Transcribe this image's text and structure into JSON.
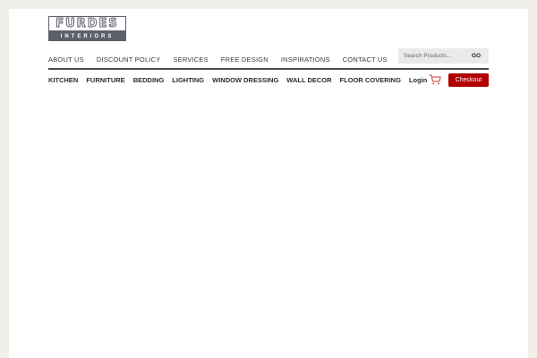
{
  "logo": {
    "top_text": "FURDES",
    "bottom_text": "INTERIORS"
  },
  "top_nav": {
    "items": [
      {
        "label": "ABOUT US"
      },
      {
        "label": "DISCOUNT POLICY"
      },
      {
        "label": "SERVICES"
      },
      {
        "label": "FREE DESIGN"
      },
      {
        "label": "INSPIRATIONS"
      },
      {
        "label": "CONTACT US"
      }
    ],
    "social_icons": [
      "facebook-icon",
      "instagram-icon"
    ]
  },
  "search": {
    "placeholder": "Search Products...",
    "button_label": "GO"
  },
  "category_nav": {
    "items": [
      {
        "label": "KITCHEN"
      },
      {
        "label": "FURNITURE"
      },
      {
        "label": "BEDDING"
      },
      {
        "label": "LIGHTING"
      },
      {
        "label": "WINDOW DRESSING"
      },
      {
        "label": "WALL DECOR"
      },
      {
        "label": "FLOOR COVERING"
      },
      {
        "label": "Login"
      }
    ]
  },
  "cart": {
    "icon": "cart-icon",
    "checkout_label": "Checkout"
  },
  "colors": {
    "background": "#f0efea",
    "accent": "#b00000",
    "logo": "#5d5f6a"
  }
}
